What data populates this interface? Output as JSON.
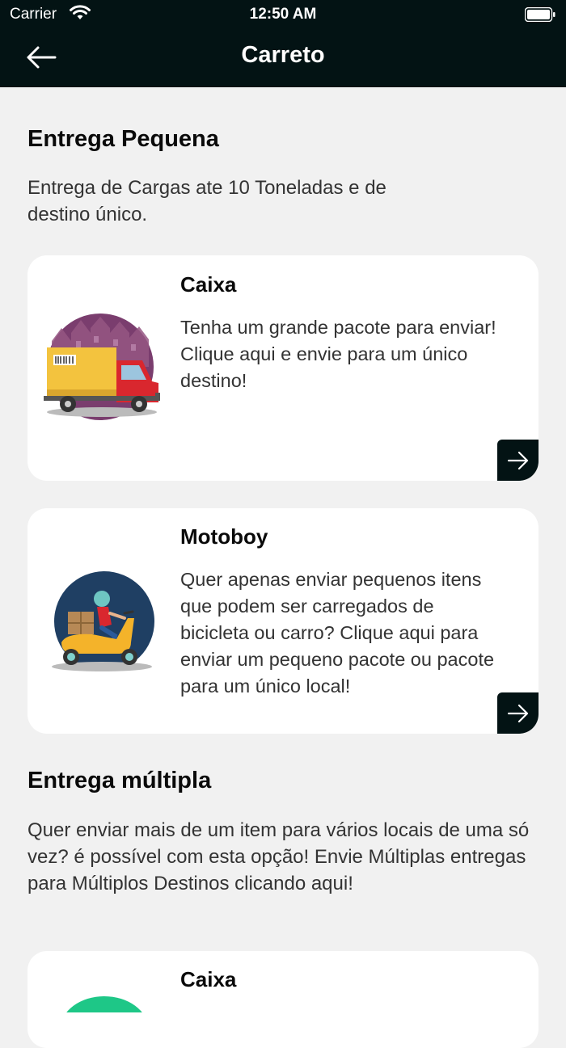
{
  "status_bar": {
    "carrier": "Carrier",
    "time": "12:50 AM"
  },
  "header": {
    "title": "Carreto"
  },
  "sections": [
    {
      "title": "Entrega Pequena",
      "description": "Entrega de Cargas ate 10 Toneladas e de destino único.",
      "cards": [
        {
          "title": "Caixa",
          "description": "Tenha um grande pacote para enviar! Clique aqui e envie para um único destino!",
          "icon": "delivery-truck"
        },
        {
          "title": "Motoboy",
          "description": "Quer apenas enviar pequenos itens que podem ser carregados de bicicleta ou carro? Clique aqui para enviar um pequeno pacote ou pacote para um único local!",
          "icon": "scooter-courier"
        }
      ]
    },
    {
      "title": "Entrega múltipla",
      "description": "Quer enviar mais de um item para vários locais de uma só vez? é possível com esta opção! Envie Múltiplas entregas para Múltiplos Destinos clicando aqui!",
      "cards": [
        {
          "title": "Caixa",
          "icon": "green-circle"
        }
      ]
    }
  ],
  "colors": {
    "header_bg": "#031314",
    "page_bg": "#f1f1f1",
    "card_bg": "#ffffff",
    "accent_green": "#1ec787"
  }
}
